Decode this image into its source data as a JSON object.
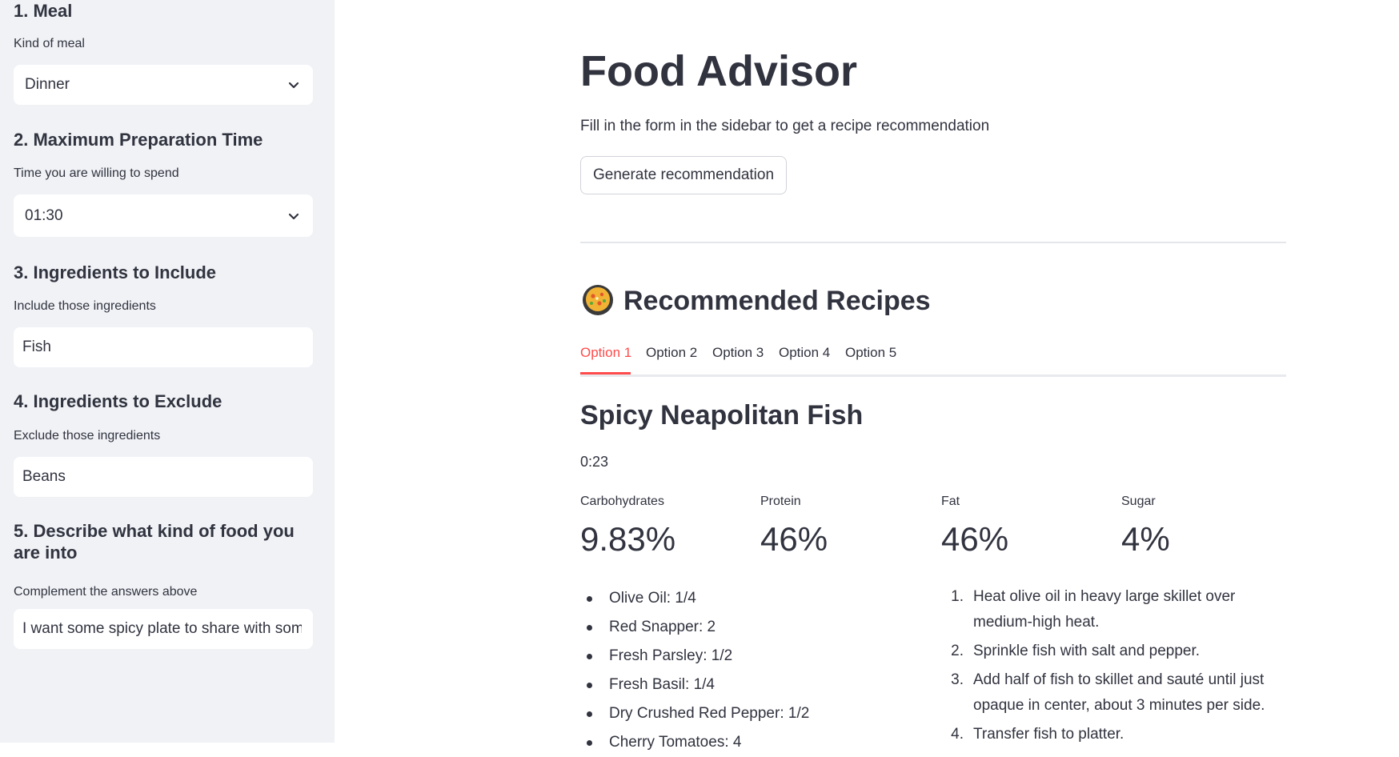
{
  "sidebar": {
    "meal": {
      "title": "1. Meal",
      "label": "Kind of meal",
      "value": "Dinner"
    },
    "prep_time": {
      "title": "2. Maximum Preparation Time",
      "label": "Time you are willing to spend",
      "value": "01:30"
    },
    "include": {
      "title": "3. Ingredients to Include",
      "label": "Include those ingredients",
      "value": "Fish"
    },
    "exclude": {
      "title": "4. Ingredients to Exclude",
      "label": "Exclude those ingredients",
      "value": "Beans"
    },
    "describe": {
      "title": "5. Describe what kind of food you are into",
      "label": "Complement the answers above",
      "value": "I want some spicy plate to share with some"
    }
  },
  "main": {
    "title": "Food Advisor",
    "subtitle": "Fill in the form in the sidebar to get a recipe recommendation",
    "generate_button": "Generate recommendation",
    "recommended_heading": "Recommended Recipes",
    "tabs": [
      "Option 1",
      "Option 2",
      "Option 3",
      "Option 4",
      "Option 5"
    ],
    "active_tab": 0,
    "recipe": {
      "name": "Spicy Neapolitan Fish",
      "time": "0:23",
      "metrics": [
        {
          "label": "Carbohydrates",
          "value": "9.83%"
        },
        {
          "label": "Protein",
          "value": "46%"
        },
        {
          "label": "Fat",
          "value": "46%"
        },
        {
          "label": "Sugar",
          "value": "4%"
        }
      ],
      "ingredients": [
        "Olive Oil: 1/4",
        "Red Snapper: 2",
        "Fresh Parsley: 1/2",
        "Fresh Basil: 1/4",
        "Dry Crushed Red Pepper: 1/2",
        "Cherry Tomatoes: 4"
      ],
      "steps": [
        {
          "num": "1.",
          "text": "Heat olive oil in heavy large skillet over medium-high heat."
        },
        {
          "num": "2.",
          "text": "Sprinkle fish with salt and pepper."
        },
        {
          "num": "3.",
          "text": "Add half of fish to skillet and sauté until just opaque in center, about 3 minutes per side."
        },
        {
          "num": "4.",
          "text": "Transfer fish to platter."
        }
      ]
    }
  },
  "colors": {
    "accent": "#ff4b4b",
    "sidebar_bg": "#f0f2f6",
    "text": "#31333f"
  },
  "icons": {
    "recipe_icon": "paella-pan-emoji",
    "select_chevron": "chevron-down-icon"
  }
}
